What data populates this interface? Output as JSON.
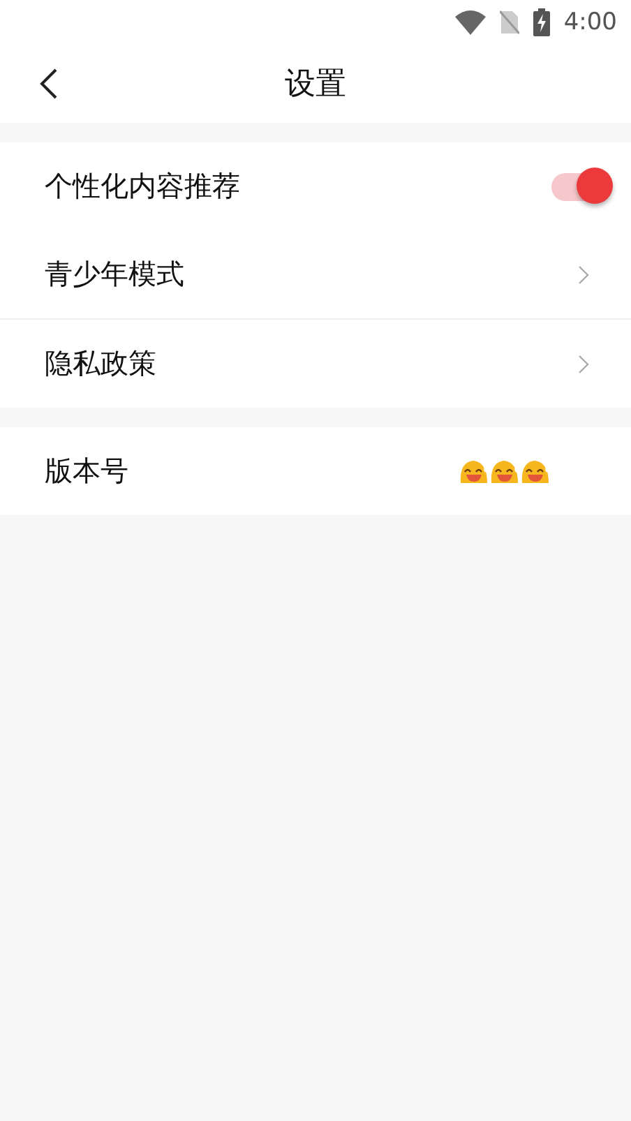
{
  "status_bar": {
    "time": "4:00"
  },
  "header": {
    "title": "设置"
  },
  "sections": [
    {
      "items": [
        {
          "kind": "toggle",
          "label": "个性化内容推荐",
          "on": true
        },
        {
          "kind": "link",
          "label": "青少年模式"
        },
        {
          "kind": "link",
          "label": "隐私政策"
        }
      ]
    },
    {
      "items": [
        {
          "kind": "emoji",
          "label": "版本号"
        }
      ]
    }
  ]
}
